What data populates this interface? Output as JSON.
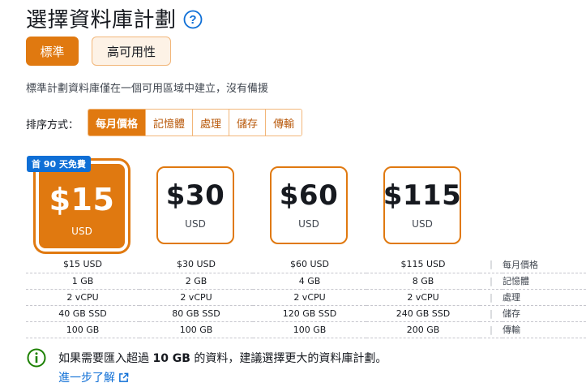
{
  "header": {
    "title": "選擇資料庫計劃",
    "help_icon": "question-circle-icon"
  },
  "plan_types": {
    "standard": "標準",
    "high_availability": "高可用性",
    "active": "standard"
  },
  "description": "標準計劃資料庫僅在一個可用區域中建立，沒有備援",
  "sort": {
    "label": "排序方式：",
    "options": [
      "每月價格",
      "記憶體",
      "處理",
      "儲存",
      "傳輸"
    ],
    "active_index": 0
  },
  "promo_badge": "首 90 天免費",
  "plans": [
    {
      "price": "$15",
      "currency": "USD",
      "selected": true
    },
    {
      "price": "$30",
      "currency": "USD",
      "selected": false
    },
    {
      "price": "$60",
      "currency": "USD",
      "selected": false
    },
    {
      "price": "$115",
      "currency": "USD",
      "selected": false
    }
  ],
  "specs": [
    {
      "values": [
        "$15 USD",
        "$30 USD",
        "$60 USD",
        "$115 USD"
      ],
      "label": "每月價格"
    },
    {
      "values": [
        "1 GB",
        "2 GB",
        "4 GB",
        "8 GB"
      ],
      "label": "記憶體"
    },
    {
      "values": [
        "2 vCPU",
        "2 vCPU",
        "2 vCPU",
        "2 vCPU"
      ],
      "label": "處理"
    },
    {
      "values": [
        "40 GB SSD",
        "80 GB SSD",
        "120 GB SSD",
        "240 GB SSD"
      ],
      "label": "儲存"
    },
    {
      "values": [
        "100 GB",
        "100 GB",
        "100 GB",
        "200 GB"
      ],
      "label": "傳輸"
    }
  ],
  "spec_separator": "|",
  "info": {
    "icon": "info-circle-icon",
    "text_before": "如果需要匯入超過 ",
    "text_bold": "10 GB",
    "text_after": " 的資料，建議選擇更大的資料庫計劃。"
  },
  "learn_more": {
    "label": "進一步了解",
    "icon": "external-link-icon"
  },
  "colors": {
    "accent": "#e07910",
    "link": "#0f6fd6",
    "success": "#1d8102"
  }
}
